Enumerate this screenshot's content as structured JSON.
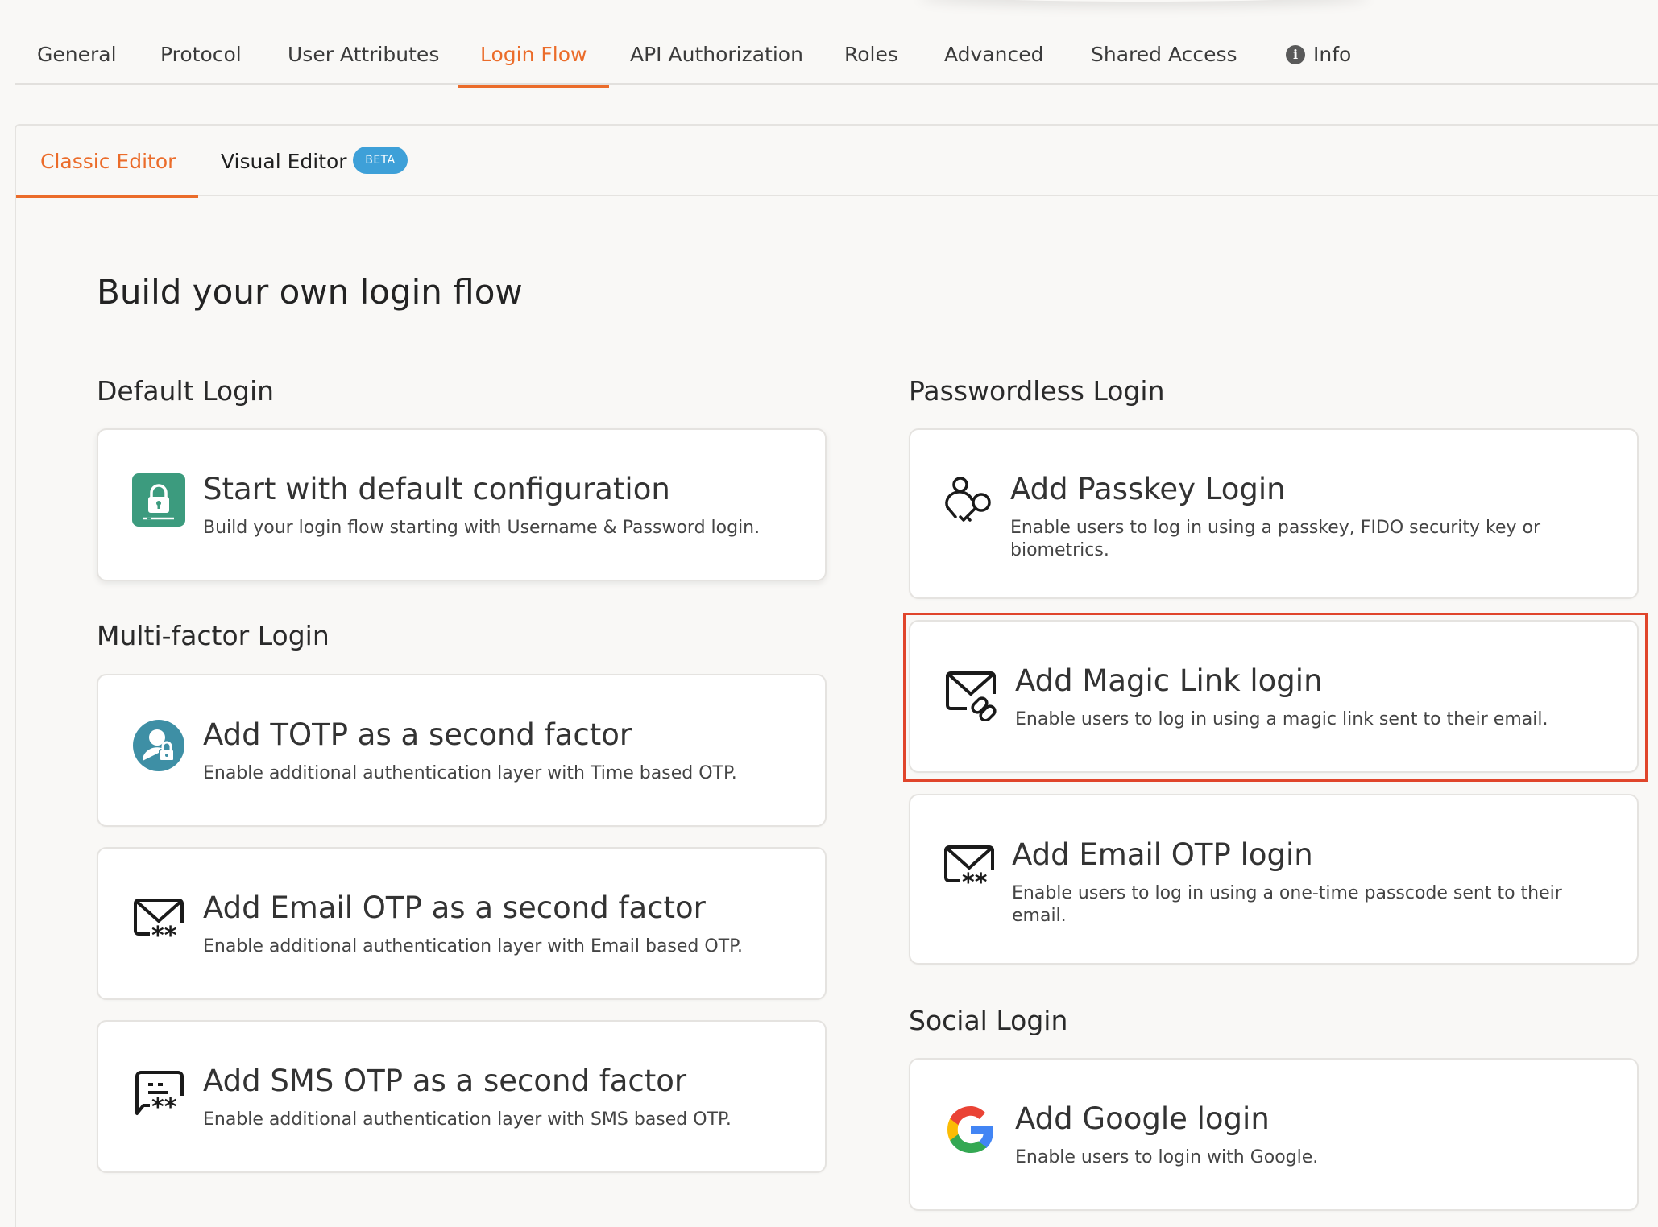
{
  "top_tabs": {
    "general": "General",
    "protocol": "Protocol",
    "user_attributes": "User Attributes",
    "login_flow": "Login Flow",
    "api_authorization": "API Authorization",
    "roles": "Roles",
    "advanced": "Advanced",
    "shared_access": "Shared Access",
    "info": "Info",
    "active": "Login Flow"
  },
  "editor_tabs": {
    "classic": "Classic Editor",
    "visual": "Visual Editor",
    "beta_badge": "BETA",
    "active": "Classic Editor"
  },
  "page_title": "Build your own login flow",
  "sections": {
    "default_login": "Default Login",
    "multi_factor_login": "Multi-factor Login",
    "passwordless_login": "Passwordless Login",
    "social_login": "Social Login"
  },
  "cards": {
    "default_config": {
      "title": "Start with default configuration",
      "description": "Build your login flow starting with Username & Password login.",
      "icon": "lock-icon"
    },
    "totp": {
      "title": "Add TOTP as a second factor",
      "description": "Enable additional authentication layer with Time based OTP.",
      "icon": "user-lock-icon"
    },
    "email_otp_mfa": {
      "title": "Add Email OTP as a second factor",
      "description": "Enable additional authentication layer with Email based OTP.",
      "icon": "email-otp-icon"
    },
    "sms_otp_mfa": {
      "title": "Add SMS OTP as a second factor",
      "description": "Enable additional authentication layer with SMS based OTP.",
      "icon": "sms-otp-icon"
    },
    "passkey": {
      "title": "Add Passkey Login",
      "description": "Enable users to log in using a passkey, FIDO security key or biometrics.",
      "icon": "passkey-icon"
    },
    "magic_link": {
      "title": "Add Magic Link login",
      "description": "Enable users to log in using a magic link sent to their email.",
      "icon": "magic-link-icon",
      "highlighted": true
    },
    "email_otp_login": {
      "title": "Add Email OTP login",
      "description": "Enable users to log in using a one-time passcode sent to their email.",
      "icon": "email-otp-icon"
    },
    "google": {
      "title": "Add Google login",
      "description": "Enable users to login with Google.",
      "icon": "google-icon"
    }
  },
  "colors": {
    "accent": "#eb6c2a",
    "beta_badge": "#3ea0d8",
    "lock_icon_bg": "#3c9b7e",
    "totp_icon_bg": "#3e8fa5",
    "highlight_border": "#e0452b"
  }
}
